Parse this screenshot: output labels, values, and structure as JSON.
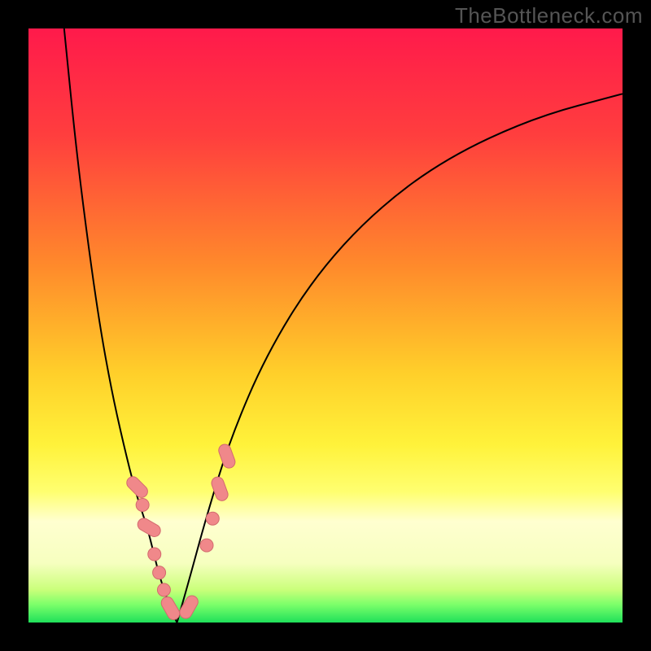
{
  "watermark": "TheBottleneck.com",
  "colors": {
    "frame": "#000000",
    "gradient_stops": [
      {
        "offset": 0.0,
        "color": "#ff1a4b"
      },
      {
        "offset": 0.18,
        "color": "#ff3e3e"
      },
      {
        "offset": 0.4,
        "color": "#ff8a2b"
      },
      {
        "offset": 0.58,
        "color": "#ffcf2a"
      },
      {
        "offset": 0.7,
        "color": "#fff23a"
      },
      {
        "offset": 0.78,
        "color": "#ffff70"
      },
      {
        "offset": 0.83,
        "color": "#ffffd0"
      },
      {
        "offset": 0.9,
        "color": "#f6ffbf"
      },
      {
        "offset": 0.945,
        "color": "#caff7a"
      },
      {
        "offset": 0.97,
        "color": "#7bff6a"
      },
      {
        "offset": 1.0,
        "color": "#1fe05a"
      }
    ],
    "curve": "#000000",
    "marker_fill": "#f0888a",
    "marker_stroke": "#d36a6e"
  },
  "chart_data": {
    "type": "line",
    "title": "",
    "xlabel": "",
    "ylabel": "",
    "xlim": [
      0,
      100
    ],
    "ylim": [
      0,
      100
    ],
    "x_optimum_percent": 25,
    "left_curve": {
      "x": [
        6,
        8,
        10,
        12,
        14,
        16,
        18,
        20,
        21,
        22,
        23,
        24,
        25
      ],
      "y": [
        100,
        80,
        64,
        50,
        39,
        30,
        22,
        16,
        12,
        8,
        5,
        2,
        0
      ]
    },
    "right_curve": {
      "x": [
        25,
        27,
        30,
        34,
        40,
        48,
        58,
        70,
        85,
        100
      ],
      "y": [
        0,
        7,
        18,
        31,
        45,
        58,
        69,
        78,
        85,
        89
      ]
    },
    "markers": [
      {
        "x": 18.3,
        "y": 22.8,
        "shape": "pill-45"
      },
      {
        "x": 19.2,
        "y": 19.8,
        "shape": "round"
      },
      {
        "x": 20.3,
        "y": 16.0,
        "shape": "pill-30"
      },
      {
        "x": 21.2,
        "y": 11.5,
        "shape": "round"
      },
      {
        "x": 22.0,
        "y": 8.4,
        "shape": "round"
      },
      {
        "x": 22.8,
        "y": 5.5,
        "shape": "round"
      },
      {
        "x": 23.9,
        "y": 2.4,
        "shape": "pill-60"
      },
      {
        "x": 27.0,
        "y": 2.6,
        "shape": "pill-120"
      },
      {
        "x": 30.0,
        "y": 13.0,
        "shape": "round"
      },
      {
        "x": 31.0,
        "y": 17.5,
        "shape": "round"
      },
      {
        "x": 32.2,
        "y": 22.5,
        "shape": "pill-70"
      },
      {
        "x": 33.4,
        "y": 28.0,
        "shape": "pill-70"
      }
    ]
  }
}
